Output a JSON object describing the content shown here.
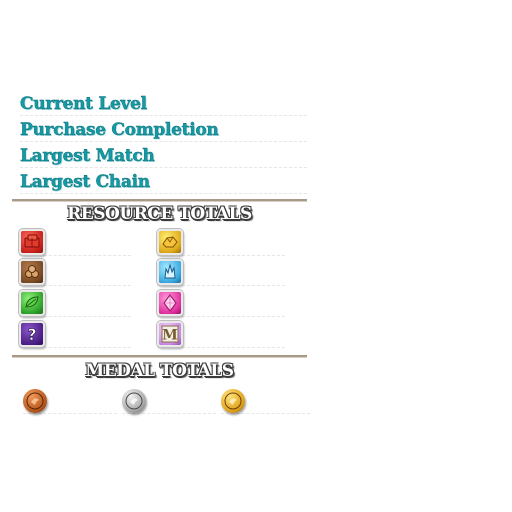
{
  "stats": [
    {
      "label": "Current Level",
      "value": ""
    },
    {
      "label": "Purchase Completion",
      "value": ""
    },
    {
      "label": "Largest Match",
      "value": ""
    },
    {
      "label": "Largest Chain",
      "value": ""
    }
  ],
  "resources": {
    "header": "Resource Totals",
    "items": [
      {
        "icon": "red-brick-icon",
        "value": ""
      },
      {
        "icon": "gold-nugget-icon",
        "value": ""
      },
      {
        "icon": "wood-logs-icon",
        "value": ""
      },
      {
        "icon": "blue-crystal-icon",
        "value": ""
      },
      {
        "icon": "green-leaf-icon",
        "value": ""
      },
      {
        "icon": "pink-gem-icon",
        "value": ""
      },
      {
        "icon": "mystery-question-icon",
        "value": ""
      },
      {
        "icon": "m-block-icon",
        "value": ""
      }
    ]
  },
  "medals": {
    "header": "Medal Totals",
    "items": [
      {
        "icon": "bronze-medal-icon",
        "value": ""
      },
      {
        "icon": "silver-medal-icon",
        "value": ""
      },
      {
        "icon": "gold-medal-icon",
        "value": ""
      }
    ]
  },
  "colors": {
    "stat_label": "#149aa4",
    "divider": "#a99989",
    "bronze": "#b5581e",
    "silver": "#a9a9a9",
    "gold": "#e0a21c"
  }
}
